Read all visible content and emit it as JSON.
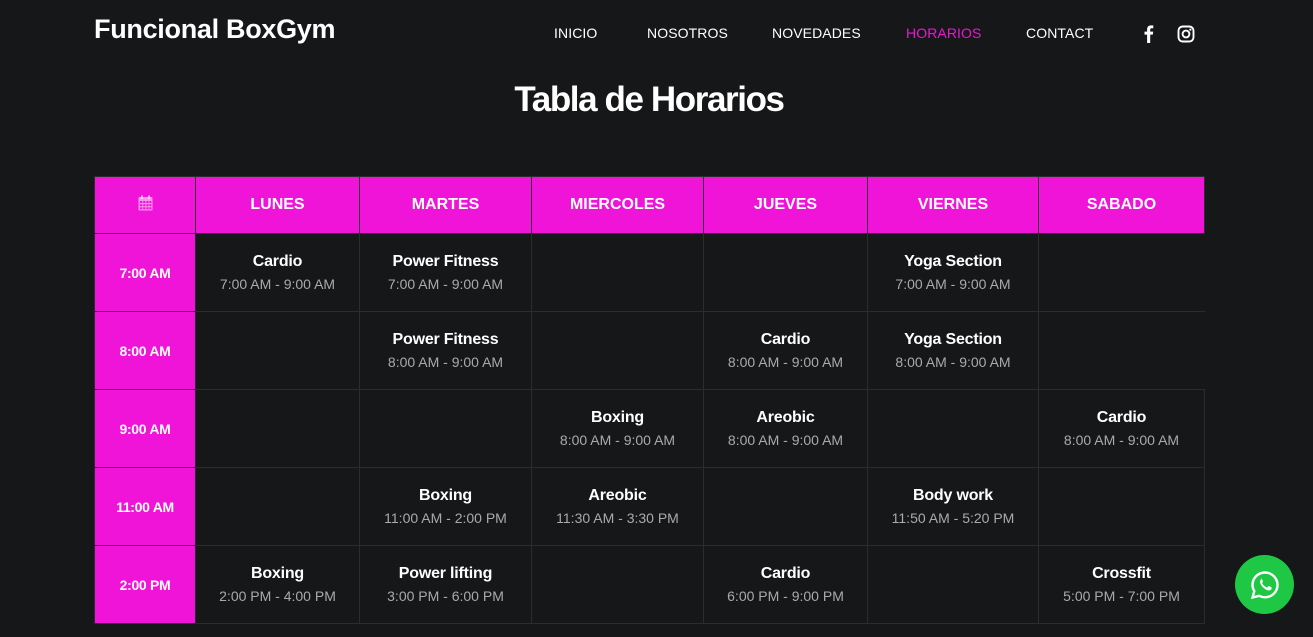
{
  "brand": "Funcional BoxGym",
  "nav": {
    "items": [
      {
        "label": "INICIO",
        "active": false
      },
      {
        "label": "NOSOTROS",
        "active": false
      },
      {
        "label": "NOVEDADES",
        "active": false
      },
      {
        "label": "HORARIOS",
        "active": true
      },
      {
        "label": "CONTACT",
        "active": false
      }
    ]
  },
  "social": [
    {
      "icon": "facebook-icon"
    },
    {
      "icon": "instagram-icon"
    }
  ],
  "page_title": "Tabla de Horarios",
  "schedule": {
    "corner_icon": "calendar-icon",
    "days": [
      "LUNES",
      "MARTES",
      "MIERCOLES",
      "JUEVES",
      "VIERNES",
      "SABADO"
    ],
    "times": [
      "7:00 AM",
      "8:00 AM",
      "9:00 AM",
      "11:00 AM",
      "2:00 PM"
    ],
    "rows": [
      [
        {
          "name": "Cardio",
          "time": "7:00 AM - 9:00 AM"
        },
        {
          "name": "Power Fitness",
          "time": "7:00 AM - 9:00 AM"
        },
        null,
        null,
        {
          "name": "Yoga Section",
          "time": "7:00 AM - 9:00 AM"
        },
        null
      ],
      [
        null,
        {
          "name": "Power Fitness",
          "time": "8:00 AM - 9:00 AM"
        },
        null,
        {
          "name": "Cardio",
          "time": "8:00 AM - 9:00 AM"
        },
        {
          "name": "Yoga Section",
          "time": "8:00 AM - 9:00 AM"
        },
        null
      ],
      [
        null,
        null,
        {
          "name": "Boxing",
          "time": "8:00 AM - 9:00 AM"
        },
        {
          "name": "Areobic",
          "time": "8:00 AM - 9:00 AM"
        },
        null,
        {
          "name": "Cardio",
          "time": "8:00 AM - 9:00 AM"
        }
      ],
      [
        null,
        {
          "name": "Boxing",
          "time": "11:00 AM - 2:00 PM"
        },
        {
          "name": "Areobic",
          "time": "11:30 AM - 3:30 PM"
        },
        null,
        {
          "name": "Body work",
          "time": "11:50 AM - 5:20 PM"
        },
        null
      ],
      [
        {
          "name": "Boxing",
          "time": "2:00 PM - 4:00 PM"
        },
        {
          "name": "Power lifting",
          "time": "3:00 PM - 6:00 PM"
        },
        null,
        {
          "name": "Cardio",
          "time": "6:00 PM - 9:00 PM"
        },
        null,
        {
          "name": "Crossfit",
          "time": "5:00 PM - 7:00 PM"
        }
      ]
    ]
  },
  "whatsapp": {
    "icon": "whatsapp-icon"
  },
  "colors": {
    "accent": "#f013d8",
    "background": "#161718",
    "muted_text": "#a9aaad",
    "whatsapp": "#1ec845"
  }
}
